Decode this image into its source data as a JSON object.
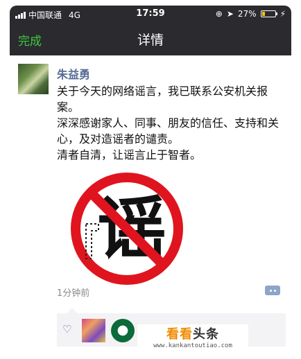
{
  "status_bar": {
    "carrier": "中国联通",
    "network": "4G",
    "time": "17:59",
    "battery_percent": "27%",
    "battery_level": 0.27
  },
  "nav": {
    "done_label": "完成",
    "title": "详情"
  },
  "post": {
    "author": "朱益勇",
    "text": "关于今天的网络谣言，我已联系公安机关报案。\n深深感谢家人、同事、朋友的信任、支持和关心，及对造谣者的谴责。\n清者自清，让谣言止于智者。",
    "image_char": "谣",
    "time": "1分钟前"
  },
  "watermark": {
    "brand_a": "看看",
    "brand_b": "头条",
    "url": "www.kankantoutiao.com"
  },
  "colors": {
    "bar_bg": "#2b2b2f",
    "accent_green": "#3ec63e",
    "link_blue": "#576b95",
    "ban_red": "#e0141e"
  }
}
